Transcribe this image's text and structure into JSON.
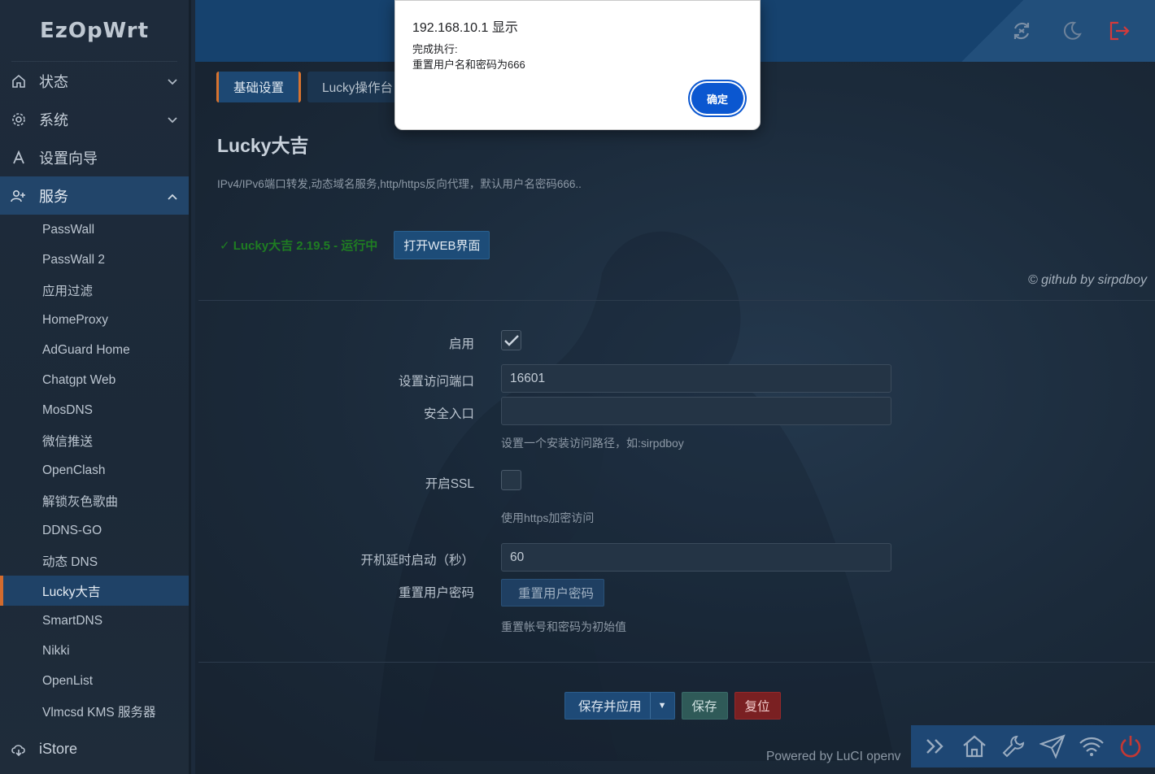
{
  "sidebar": {
    "brand": "EzOpWrt",
    "menus": [
      {
        "label": "状态",
        "icon": "home-icon"
      },
      {
        "label": "系统",
        "icon": "gear-icon"
      },
      {
        "label": "设置向导",
        "icon": "wizard-icon"
      },
      {
        "label": "服务",
        "icon": "users-icon"
      }
    ],
    "items": [
      "PassWall",
      "PassWall 2",
      "应用过滤",
      "HomeProxy",
      "AdGuard Home",
      "Chatgpt Web",
      "MosDNS",
      "微信推送",
      "OpenClash",
      "解锁灰色歌曲",
      "DDNS-GO",
      "动态 DNS",
      "Lucky大吉",
      "SmartDNS",
      "Nikki",
      "OpenList",
      "Vlmcsd KMS 服务器"
    ],
    "istore": "iStore"
  },
  "tabs": [
    "基础设置",
    "Lucky操作台"
  ],
  "page": {
    "title": "Lucky大吉",
    "description": "IPv4/IPv6端口转发,动态域名服务,http/https反向代理，默认用户名密码666..",
    "status": "✓ Lucky大吉 2.19.5 - 运行中",
    "open_web": "打开WEB界面",
    "credit": "© github by sirpdboy"
  },
  "form": {
    "enable_label": "启用",
    "port_label": "设置访问端口",
    "port_value": "16601",
    "entry_label": "安全入口",
    "entry_value": "",
    "entry_hint": "设置一个安装访问路径，如:sirpdboy",
    "ssl_label": "开启SSL",
    "ssl_hint": "使用https加密访问",
    "delay_label": "开机延时启动（秒）",
    "delay_value": "60",
    "reset_label": "重置用户密码",
    "reset_button": "重置用户密码",
    "reset_hint": "重置帐号和密码为初始值"
  },
  "actions": {
    "save_apply": "保存并应用",
    "save": "保存",
    "reset": "复位"
  },
  "footer": {
    "powered": "Powered by LuCI openv"
  },
  "dialog": {
    "title": "192.168.10.1 显示",
    "line1": "完成执行:",
    "line2": "重置用户名和密码为666",
    "ok": "确定"
  }
}
